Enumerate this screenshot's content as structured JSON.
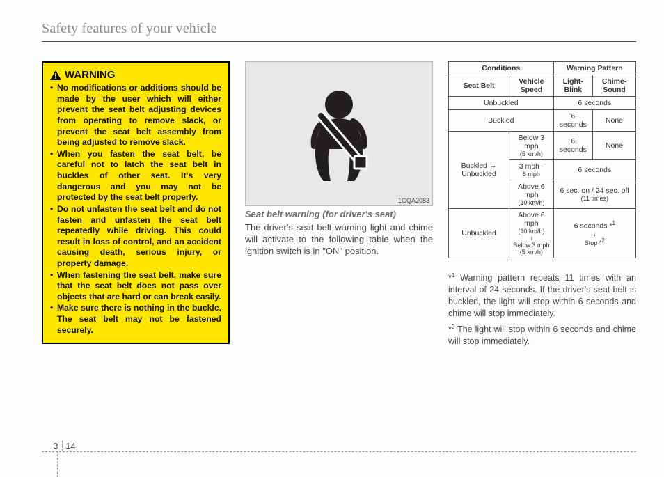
{
  "header": "Safety features of your vehicle",
  "warning": {
    "title": "WARNING",
    "items": [
      "No modifications or additions should be made by the user which will either prevent the seat belt adjusting devices from operating to remove slack, or prevent the seat belt assembly from being adjusted to remove slack.",
      "When you fasten the seat belt, be careful not to latch the seat belt in buckles of other seat. It's very dangerous and you may not be protected by the seat belt properly.",
      "Do not unfasten the seat belt and do not fasten and unfasten the seat belt repeatedly while driving. This could result in loss of control, and an accident causing death, serious injury, or property damage.",
      "When fastening the seat belt, make sure that the seat belt does not pass over objects that are hard or can break easily.",
      "Make sure there is nothing in the buckle. The seat belt may not be fastened securely."
    ]
  },
  "figure": {
    "code": "1GQA2083"
  },
  "caption": "Seat belt warning (for driver's seat)",
  "bodyText": "The driver's seat belt warning light and chime will activate to the following table when the ignition switch is in \"ON\" position.",
  "table": {
    "head": {
      "conditions": "Conditions",
      "pattern": "Warning Pattern",
      "seatBelt": "Seat Belt",
      "speed": "Vehicle Speed",
      "light": "Light-Blink",
      "chime": "Chime-Sound"
    },
    "rows": {
      "r1_belt": "Unbuckled",
      "r1_pat": "6 seconds",
      "r2_belt": "Buckled",
      "r2_light": "6 seconds",
      "r2_chime": "None",
      "r3_belt": "Buckled → Unbuckled",
      "r3a_speed": "Below 3 mph",
      "r3a_speed2": "(5 km/h)",
      "r3a_light": "6 seconds",
      "r3a_chime": "None",
      "r3b_speed": "3 mph~",
      "r3b_speed2": "6 mph",
      "r3b_pat": "6 seconds",
      "r3c_speed": "Above 6 mph",
      "r3c_speed2": "(10 km/h)",
      "r3c_pat": "6 sec. on / 24 sec. off",
      "r3c_pat2": "(11 times)",
      "r4_belt": "Unbuckled",
      "r4_speed1": "Above 6 mph",
      "r4_speed2": "(10 km/h)",
      "r4_speed3": "↓",
      "r4_speed4": "Below 3 mph",
      "r4_speed5": "(5 km/h)",
      "r4_pat1": "6 seconds *",
      "r4_pat1s": "1",
      "r4_pat2": "↓",
      "r4_pat3": "Stop *",
      "r4_pat3s": "2"
    }
  },
  "footnotes": {
    "f1a": "*",
    "f1s": "1",
    "f1b": " Warning pattern repeats 11 times with an interval of 24 seconds. If the driver's seat belt is buckled, the light will stop within 6 seconds and chime will stop immediately.",
    "f2a": "*",
    "f2s": "2",
    "f2b": " The light will stop within 6 seconds and chime will stop immediately."
  },
  "pageNum": {
    "chapter": "3",
    "page": "14"
  }
}
